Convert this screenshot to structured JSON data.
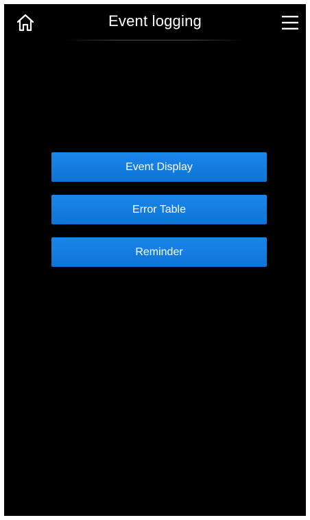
{
  "header": {
    "title": "Event logging",
    "home_icon": "home-icon",
    "menu_icon": "hamburger-menu-icon"
  },
  "menu": {
    "items": [
      {
        "label": "Event Display"
      },
      {
        "label": "Error Table"
      },
      {
        "label": "Reminder"
      }
    ]
  },
  "colors": {
    "background": "#000000",
    "button": "#1580e2",
    "text": "#ffffff"
  }
}
